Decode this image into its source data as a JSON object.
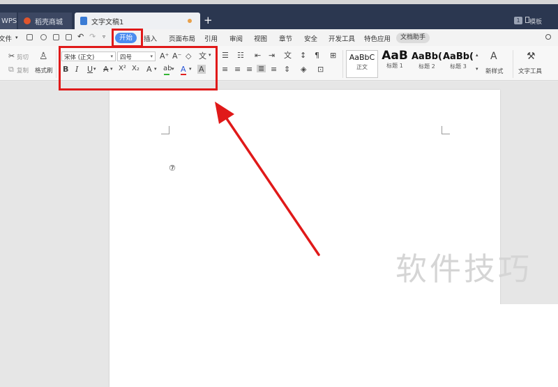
{
  "tabs": {
    "wps_label": "WPS",
    "store_label": "稻壳商城",
    "doc_label": "文字文稿1",
    "new_tab_symbol": "+",
    "right_badge": "1",
    "right_label": "模板"
  },
  "menu": {
    "file_label": "文件",
    "items": [
      "开始",
      "插入",
      "页面布局",
      "引用",
      "审阅",
      "视图",
      "章节",
      "安全",
      "开发工具",
      "特色应用",
      "文档助手"
    ],
    "search_label": "Q"
  },
  "ribbon": {
    "cut_label": "剪切",
    "copy_label": "复制",
    "format_painter_label": "格式刷",
    "font_name": "宋体 (正文)",
    "font_size": "四号",
    "bold": "B",
    "italic": "I",
    "underline": "U",
    "strike": "A",
    "superscript": "X²",
    "subscript": "X₂",
    "text_effect": "A",
    "highlight": "ab",
    "font_color": "A",
    "char_shading": "A",
    "grow_font": "A⁺",
    "shrink_font": "A⁻",
    "clear_format": "◇",
    "phonetic": "文",
    "styles": [
      {
        "sample": "AaBbC",
        "label": "正文"
      },
      {
        "sample": "AaB",
        "label": "标题 1"
      },
      {
        "sample": "AaBb(",
        "label": "标题 2"
      },
      {
        "sample": "AaBb(",
        "label": "标题 3"
      }
    ],
    "new_style_label": "新样式",
    "text_tools_label": "文字工具"
  },
  "document": {
    "content": "⑦"
  },
  "watermark": "软件技巧",
  "colors": {
    "tab_bg": "#2b3750",
    "active_tab": "#4b8cf0",
    "annotation": "#e01919",
    "highlight_green": "#35b535",
    "font_color_red": "#e02020",
    "font_color_blue": "#2b57d6"
  }
}
